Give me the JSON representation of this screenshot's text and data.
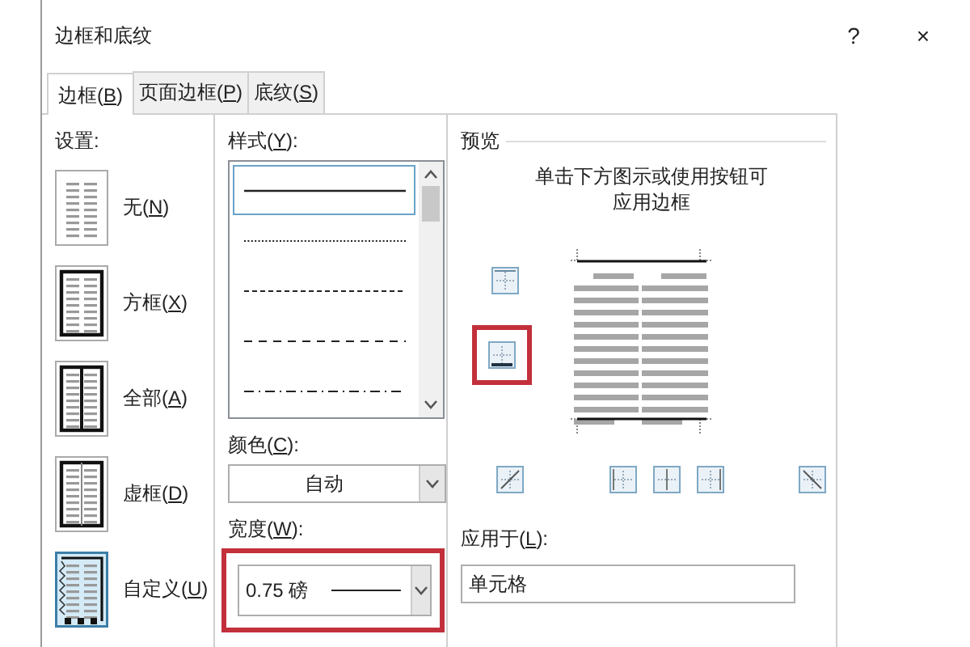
{
  "window": {
    "title": "边框和底纹",
    "help": "?",
    "close": "×"
  },
  "tabs": [
    {
      "label": "边框(B)",
      "selected": true
    },
    {
      "label": "页面边框(P)",
      "selected": false
    },
    {
      "label": "底纹(S)",
      "selected": false
    }
  ],
  "settings": {
    "label": "设置:",
    "items": [
      {
        "kind": "none",
        "label": "无(N)",
        "selected": false
      },
      {
        "kind": "box",
        "label": "方框(X)",
        "selected": false
      },
      {
        "kind": "all",
        "label": "全部(A)",
        "selected": false
      },
      {
        "kind": "grid",
        "label": "虚框(D)",
        "selected": false
      },
      {
        "kind": "custom",
        "label": "自定义(U)",
        "selected": true
      }
    ]
  },
  "style": {
    "label": "样式(Y):",
    "lines": [
      {
        "kind": "solid",
        "selected": true
      },
      {
        "kind": "dotted",
        "selected": false
      },
      {
        "kind": "dashed",
        "selected": false
      },
      {
        "kind": "dashed-wide",
        "selected": false
      },
      {
        "kind": "dash-dot",
        "selected": false
      }
    ]
  },
  "color": {
    "label": "颜色(C):",
    "value": "自动"
  },
  "width": {
    "label": "宽度(W):",
    "value": "0.75 磅",
    "highlighted": true
  },
  "preview": {
    "title": "预览",
    "hint": "单击下方图示或使用按钮可应用边框",
    "side_buttons": [
      {
        "kind": "top",
        "highlighted": false
      },
      {
        "kind": "bottom",
        "highlighted": true
      }
    ],
    "bottom_buttons": [
      {
        "kind": "diag-up",
        "highlighted": false
      },
      {
        "kind": "left",
        "highlighted": false
      },
      {
        "kind": "inner-vertical",
        "highlighted": false
      },
      {
        "kind": "right",
        "highlighted": false
      },
      {
        "kind": "diag-down",
        "highlighted": false
      }
    ]
  },
  "apply_to": {
    "label": "应用于(L):",
    "value": "单元格"
  }
}
